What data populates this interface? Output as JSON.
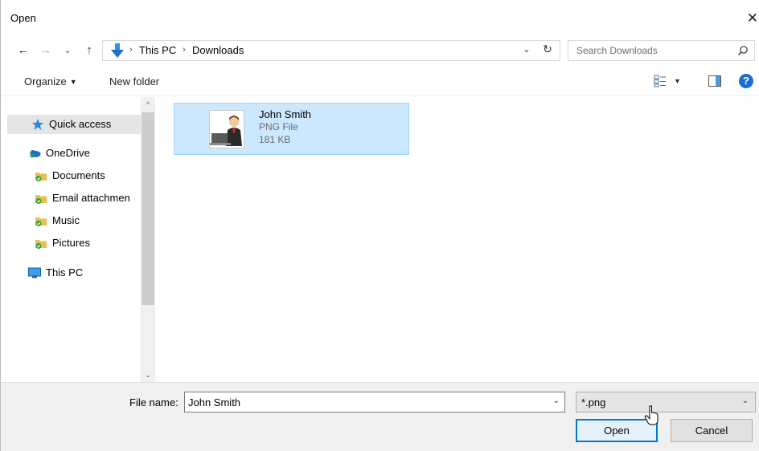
{
  "window": {
    "title": "Open",
    "close_glyph": "✕"
  },
  "nav": {
    "back_glyph": "←",
    "forward_glyph": "→",
    "recent_glyph": "⌄",
    "up_glyph": "↑"
  },
  "address": {
    "crumbs": [
      "This PC",
      "Downloads"
    ],
    "separator": "›",
    "dropdown_glyph": "⌄",
    "refresh_glyph": "↻"
  },
  "search": {
    "placeholder": "Search Downloads",
    "value": ""
  },
  "toolbar": {
    "organize_label": "Organize",
    "organize_caret": "▼",
    "new_folder_label": "New folder",
    "view_caret": "▼",
    "help_glyph": "?"
  },
  "sidebar": {
    "items": [
      {
        "label": "Quick access",
        "icon": "star-icon",
        "selected": true
      },
      {
        "label": "OneDrive",
        "icon": "cloud-icon",
        "selected": false
      },
      {
        "label": "Documents",
        "icon": "synced-folder-icon",
        "selected": false
      },
      {
        "label": "Email attachmen",
        "icon": "synced-folder-icon",
        "selected": false
      },
      {
        "label": "Music",
        "icon": "synced-folder-icon",
        "selected": false
      },
      {
        "label": "Pictures",
        "icon": "synced-folder-icon",
        "selected": false
      },
      {
        "label": "This PC",
        "icon": "monitor-icon",
        "selected": false
      }
    ],
    "scroll_up_glyph": "^",
    "scroll_down_glyph": "⌄"
  },
  "files": [
    {
      "name": "John Smith",
      "type": "PNG File",
      "size": "181 KB",
      "selected": true,
      "icon": "image-thumbnail"
    }
  ],
  "footer": {
    "filename_label": "File name:",
    "filename_value": "John Smith",
    "filename_caret": "⌄",
    "filetype_value": "*.png",
    "filetype_caret": "⌄",
    "open_label": "Open",
    "cancel_label": "Cancel"
  },
  "colors": {
    "selection_bg": "#cce8ff",
    "selection_border": "#99d1ff",
    "accent": "#0078d7",
    "help_blue": "#1a6fd1"
  }
}
